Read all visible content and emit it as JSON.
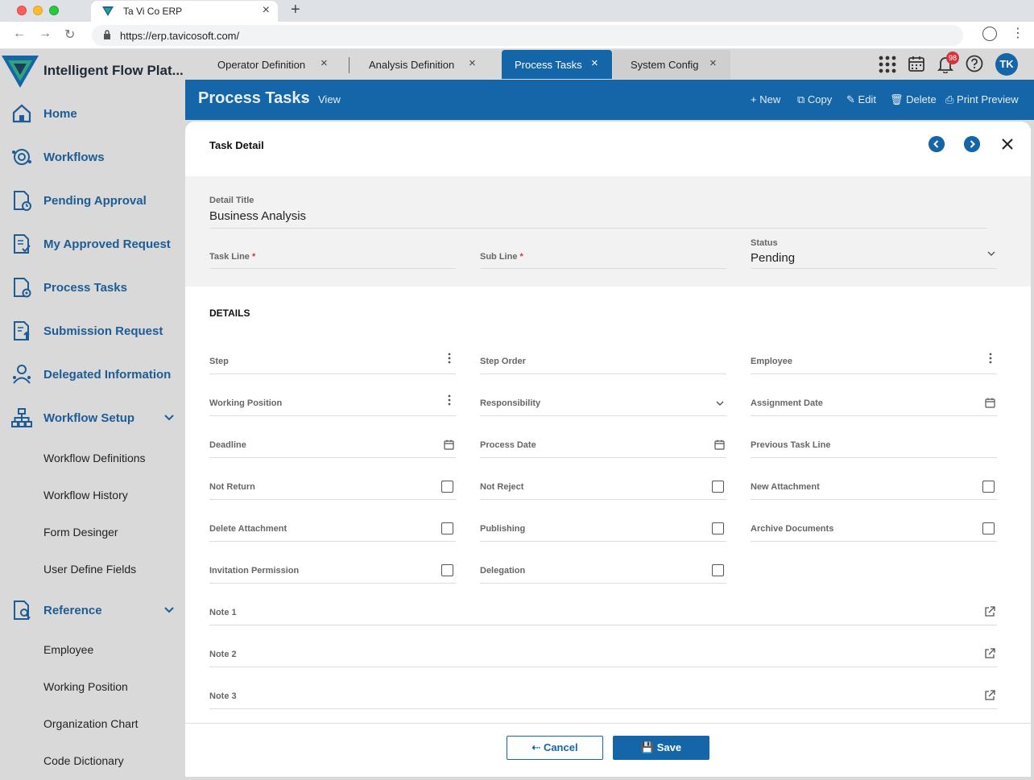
{
  "browser": {
    "tab_title": "Ta Vi Co ERP",
    "url": "https://erp.tavicosoft.com/"
  },
  "sidebar": {
    "brand": "Intelligent Flow Plat...",
    "items": [
      {
        "label": "Home",
        "icon": "home-icon"
      },
      {
        "label": "Workflows",
        "icon": "workflow-icon"
      },
      {
        "label": "Pending Approval",
        "icon": "pending-doc-icon"
      },
      {
        "label": "My Approved Request",
        "icon": "approved-doc-icon"
      },
      {
        "label": "Process Tasks",
        "icon": "process-doc-icon"
      },
      {
        "label": "Submission Request",
        "icon": "submission-doc-icon"
      },
      {
        "label": "Delegated Information",
        "icon": "delegate-icon"
      },
      {
        "label": "Workflow Setup",
        "icon": "org-tree-icon"
      }
    ],
    "workflow_setup_sub": [
      "Workflow Definitions",
      "Workflow History",
      "Form Desinger",
      "User Define Fields"
    ],
    "reference": {
      "label": "Reference",
      "icon": "reference-icon"
    },
    "reference_sub": [
      "Employee",
      "Working Position",
      "Organization Chart",
      "Code Dictionary"
    ]
  },
  "app_tabs": [
    {
      "label": "Operator Definition",
      "active": false
    },
    {
      "label": "Analysis Definition",
      "active": false
    },
    {
      "label": "Process Tasks",
      "active": true
    },
    {
      "label": "System Config",
      "active": false
    }
  ],
  "header_icons": {
    "notifications_count": "98",
    "avatar_initials": "TK"
  },
  "title_bar": {
    "title": "Process Tasks",
    "breadcrumb": "View",
    "tools": {
      "new": "New",
      "copy": "Copy",
      "edit": "Edit",
      "delete": "Delete",
      "print": "Print Preview"
    }
  },
  "panel": {
    "title": "Task Detail",
    "detail_title_label": "Detail Title",
    "detail_title_value": "Business Analysis",
    "task_line_label": "Task Line",
    "sub_line_label": "Sub Line",
    "status_label": "Status",
    "status_value": "Pending",
    "details_heading": "DETAILS",
    "fields": {
      "step": "Step",
      "step_order": "Step Order",
      "employee": "Employee",
      "working_position": "Working Position",
      "responsibility": "Responsibility",
      "assignment_date": "Assignment Date",
      "deadline": "Deadline",
      "process_date": "Process Date",
      "previous_task_line": "Previous Task Line",
      "not_return": "Not Return",
      "not_reject": "Not Reject",
      "new_attachment": "New Attachment",
      "delete_attachment": "Delete Attachment",
      "publishing": "Publishing",
      "archive_documents": "Archive Documents",
      "invitation_permission": "Invitation Permission",
      "delegation": "Delegation",
      "note1": "Note 1",
      "note2": "Note 2",
      "note3": "Note 3"
    },
    "cancel_label": "Cancel",
    "save_label": "Save"
  },
  "colors": {
    "primary": "#1466a8",
    "sidebar_bg": "#d9d9d9",
    "required": "#d4353d"
  }
}
